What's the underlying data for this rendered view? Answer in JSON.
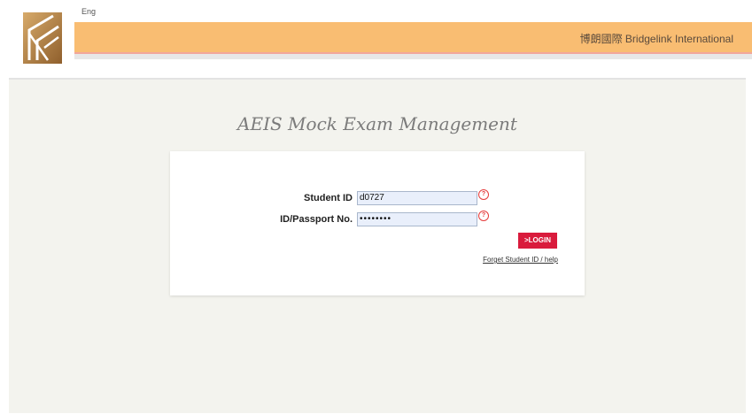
{
  "header": {
    "language": "Eng",
    "brand": "博朗國際 Bridgelink International",
    "colors": {
      "banner": "#f9bd72",
      "accent_line": "#f2a69b",
      "logo": "#b8874a"
    }
  },
  "main": {
    "title": "AEIS Mock Exam Management"
  },
  "login_form": {
    "student_id_label": "Student ID",
    "student_id_value": "d0727",
    "passport_label": "ID/Passport No.",
    "passport_value": "••••••••",
    "help_icon": "?",
    "login_button": ">LOGIN",
    "forget_link": "Forget Student ID / help",
    "colors": {
      "button": "#d91b3c",
      "help": "#e53b3b"
    }
  }
}
